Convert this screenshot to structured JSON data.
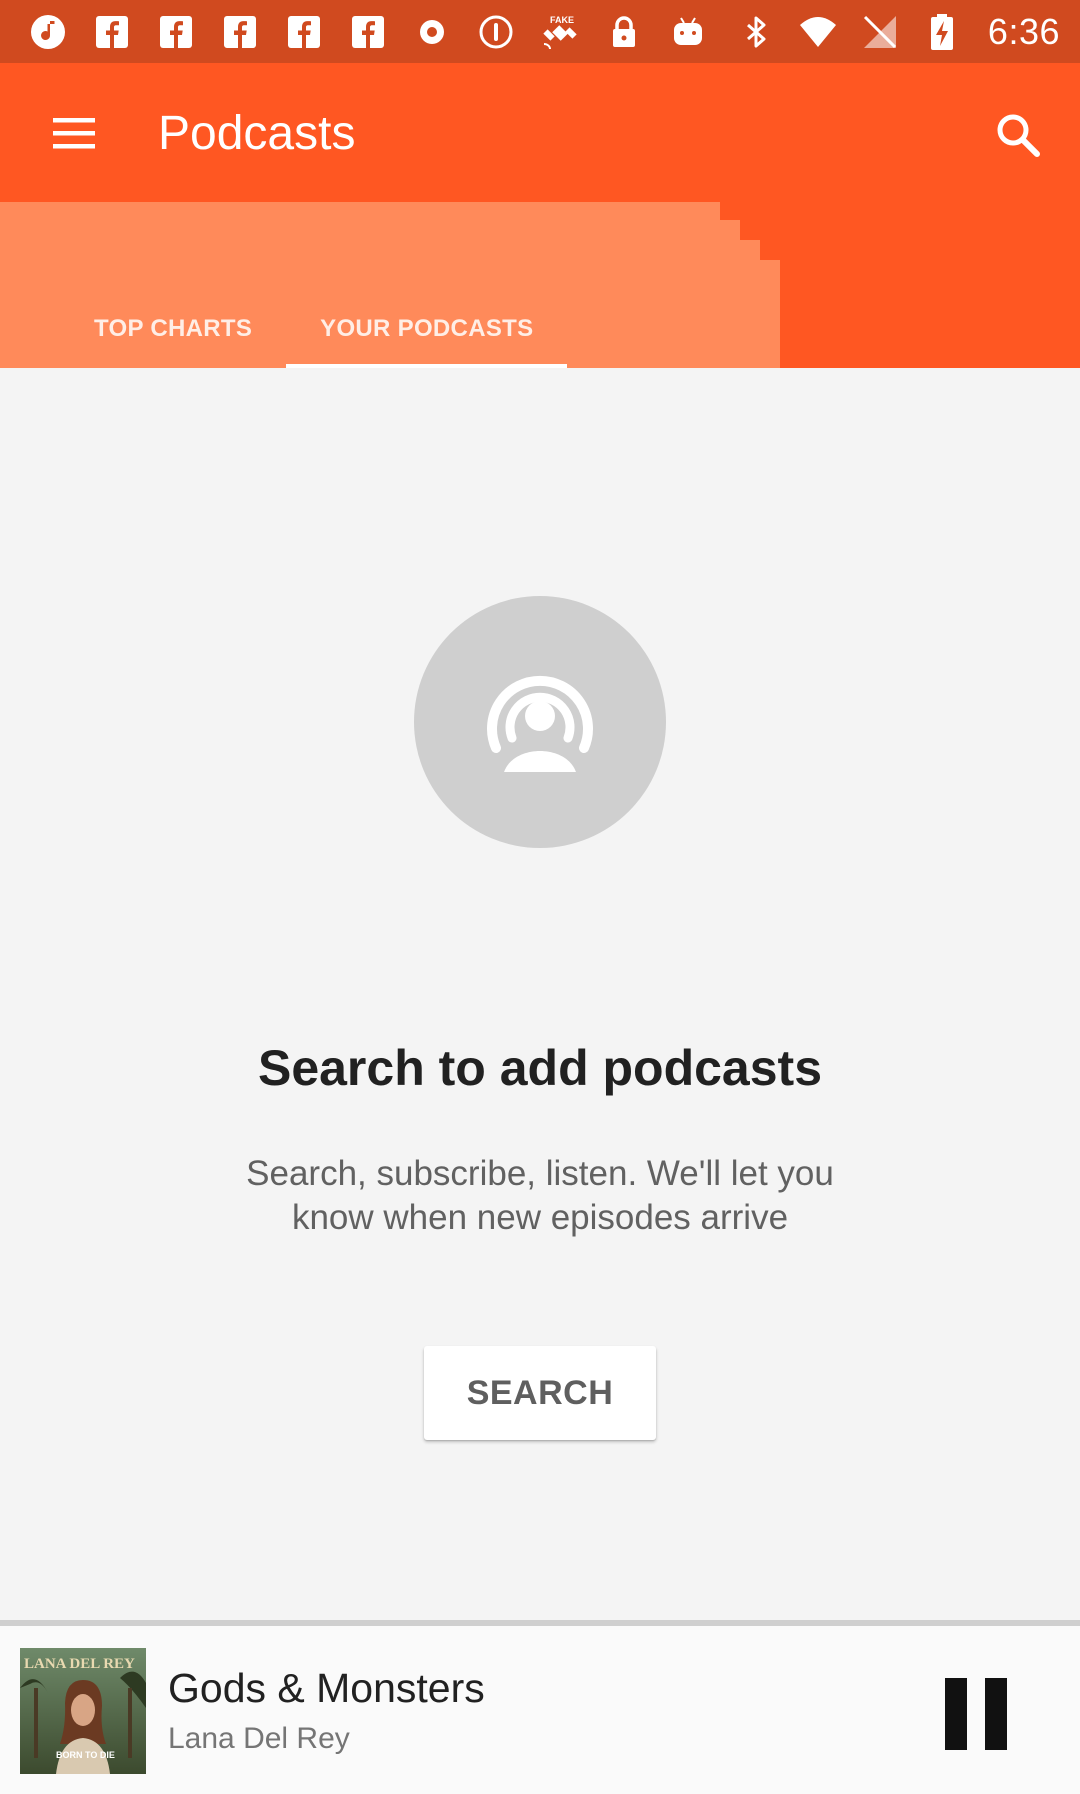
{
  "status_bar": {
    "time": "6:36",
    "left_icons": [
      "music-note-icon",
      "facebook-icon",
      "facebook-icon",
      "facebook-icon",
      "facebook-icon",
      "facebook-icon",
      "record-icon",
      "info-circle-icon",
      "fake-gps-satellite-icon",
      "lock-icon",
      "android-icon"
    ],
    "right_icons": [
      "bluetooth-icon",
      "wifi-icon",
      "signal-off-icon",
      "battery-charging-icon"
    ],
    "background_color": "#d04a1f"
  },
  "app_bar": {
    "title": "Podcasts",
    "background_color": "#ff5722"
  },
  "tabs": [
    {
      "label": "TOP CHARTS",
      "active": false
    },
    {
      "label": "YOUR PODCASTS",
      "active": true
    }
  ],
  "empty_state": {
    "icon": "podcast-icon",
    "title": "Search to add podcasts",
    "description": "Search, subscribe, listen. We'll let you know when new episodes arrive",
    "button_label": "SEARCH"
  },
  "now_playing": {
    "track_title": "Gods & Monsters",
    "artist": "Lana Del Rey",
    "control_icon": "pause-icon",
    "album_art_text": "LANA DEL REY",
    "album_art_subtext": "BORN TO DIE"
  }
}
